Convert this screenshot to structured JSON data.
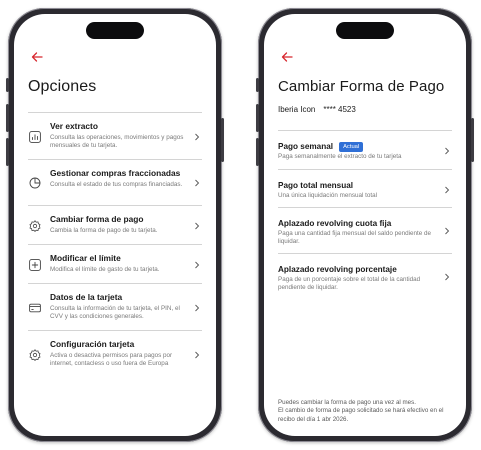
{
  "left": {
    "title": "Opciones",
    "items": [
      {
        "title": "Ver extracto",
        "desc": "Consulta las operaciones, movimientos y pagos mensuales de tu tarjeta.",
        "icon": "chart-icon"
      },
      {
        "title": "Gestionar compras fraccionadas",
        "desc": "Consulta el estado de tus compras financiadas.",
        "icon": "pie-chart-icon"
      },
      {
        "title": "Cambiar forma de pago",
        "desc": "Cambia la forma de pago de tu tarjeta.",
        "icon": "settings-gear-icon"
      },
      {
        "title": "Modificar el límite",
        "desc": "Modifica el límite de gasto de tu tarjeta.",
        "icon": "plus-square-icon"
      },
      {
        "title": "Datos de la tarjeta",
        "desc": "Consulta la información de tu tarjeta, el PIN, el CVV y las condiciones generales.",
        "icon": "credit-card-icon"
      },
      {
        "title": "Configuración tarjeta",
        "desc": "Activa o desactiva permisos para pagos por internet, contacless o uso fuera de Europa",
        "icon": "gear-icon"
      }
    ]
  },
  "right": {
    "title": "Cambiar Forma de Pago",
    "card_name": "Iberia Icon",
    "card_mask": "**** 4523",
    "items": [
      {
        "title": "Pago semanal",
        "badge": "Actual",
        "desc": "Paga semanalmente el extracto de tu tarjeta"
      },
      {
        "title": "Pago total mensual",
        "desc": "Una única liquidación mensual total"
      },
      {
        "title": "Aplazado revolving cuota fija",
        "desc": "Paga una cantidad fija mensual del saldo pendiente de liquidar."
      },
      {
        "title": "Aplazado revolving porcentaje",
        "desc": "Paga de un porcentaje sobre el total de la cantidad pendiente de liquidar."
      }
    ],
    "footer_line1": "Puedes cambiar la forma de pago una vez al mes.",
    "footer_line2": "El cambio de forma de pago solicitado se hará efectivo en el recibo del día 1 abr 2026."
  },
  "colors": {
    "accent_red": "#d7282f",
    "badge_blue": "#2f6fd6",
    "divider": "#d4d4d4",
    "frame": "#2b2a30"
  }
}
